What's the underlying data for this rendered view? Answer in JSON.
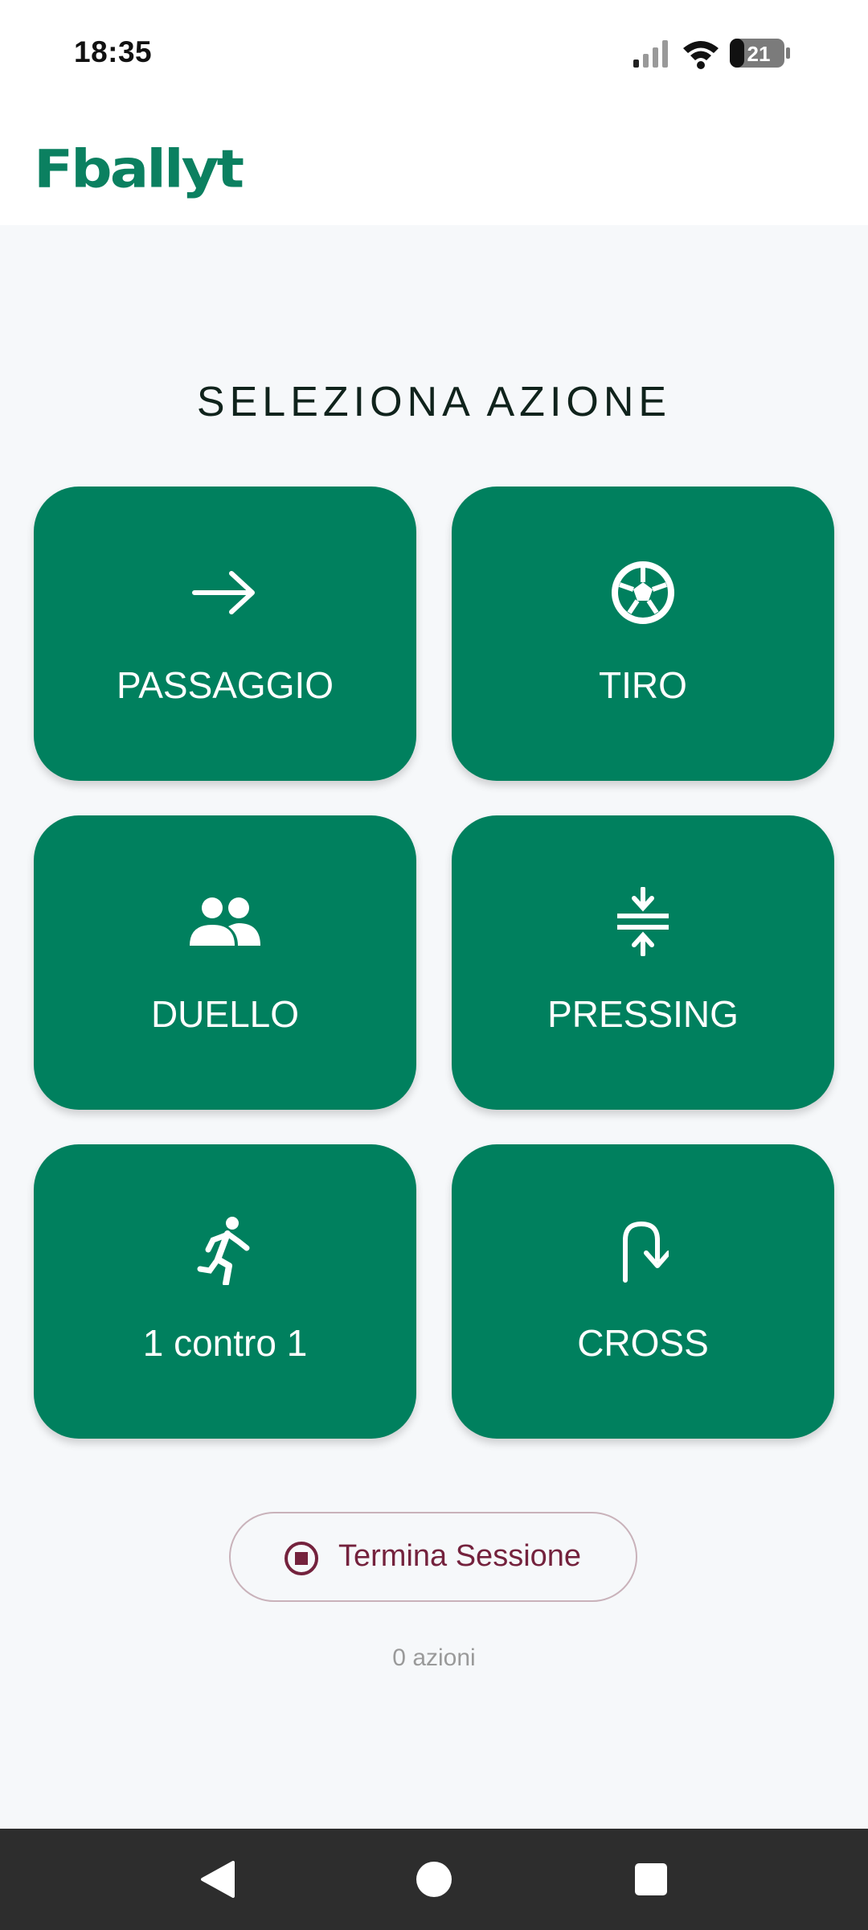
{
  "status_bar": {
    "time": "18:35",
    "battery": "21",
    "icons": [
      "signal-icon",
      "wifi-icon",
      "battery-icon"
    ]
  },
  "app": {
    "logo_text": "Fballyt",
    "brand_color": "#00805e"
  },
  "main": {
    "heading": "SELEZIONA AZIONE",
    "actions": [
      {
        "label": "PASSAGGIO",
        "icon": "arrow-right-icon"
      },
      {
        "label": "TIRO",
        "icon": "soccer-ball-icon"
      },
      {
        "label": "DUELLO",
        "icon": "people-icon"
      },
      {
        "label": "PRESSING",
        "icon": "compress-icon"
      },
      {
        "label": "1 contro 1",
        "icon": "running-icon"
      },
      {
        "label": "CROSS",
        "icon": "curved-arrow-icon"
      }
    ],
    "end_session_label": "Termina Sessione",
    "action_count": "0 azioni"
  },
  "nav_bar": {
    "items": [
      "back-icon",
      "home-icon",
      "recents-icon"
    ]
  }
}
